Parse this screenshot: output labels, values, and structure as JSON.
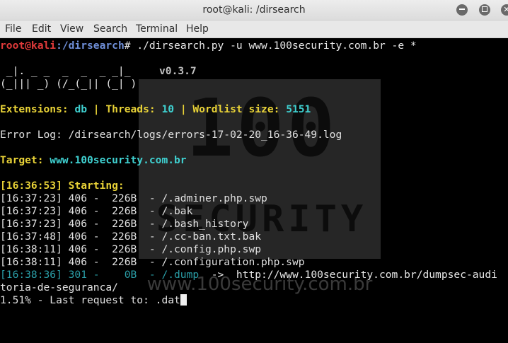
{
  "window": {
    "title": "root@kali: /dirsearch",
    "minimize_label": "",
    "maximize_label": "",
    "close_label": "✕"
  },
  "menu": [
    "File",
    "Edit",
    "View",
    "Search",
    "Terminal",
    "Help"
  ],
  "watermark": {
    "big": "100",
    "sec": "SECURITY",
    "url": "www.100security.com.br"
  },
  "prompt": {
    "user_host": "root@kali",
    "path": ":/dirsearch",
    "symbol": "#",
    "command": " ./dirsearch.py -u www.100security.com.br -e *"
  },
  "logo": {
    "line1": " _|. _ _  _  _  _ _|_",
    "line2": "(_||| _) (/_(_|| (_| )",
    "version": "v0.3.7"
  },
  "config": {
    "ext_label": "Extensions: ",
    "ext_value": "db",
    "sep1": " | ",
    "threads_label": "Threads: ",
    "threads_value": "10",
    "sep2": " | ",
    "wordlist_label": "Wordlist size: ",
    "wordlist_value": "5151"
  },
  "error_log": "Error Log: /dirsearch/logs/errors-17-02-20_16-36-49.log",
  "target": {
    "label": "Target: ",
    "value": "www.100security.com.br"
  },
  "starting": "[16:36:53] Starting:",
  "results": [
    "[16:37:23] 406 -  226B  - /.adminer.php.swp",
    "[16:37:23] 406 -  226B  - /.bak",
    "[16:37:23] 406 -  226B  - /.bash_history",
    "[16:37:48] 406 -  226B  - /.cc-ban.txt.bak",
    "[16:38:11] 406 -  226B  - /.config.php.swp",
    "[16:38:11] 406 -  226B  - /.configuration.php.swp"
  ],
  "redirect": {
    "entry": "[16:38:36] 301 -    0B  - /.dump",
    "arrow": "  ->  ",
    "url": "http://www.100security.com.br/dumpsec-audi",
    "wrap": "toria-de-seguranca/"
  },
  "progress": "1.51% - Last request to: .dat"
}
